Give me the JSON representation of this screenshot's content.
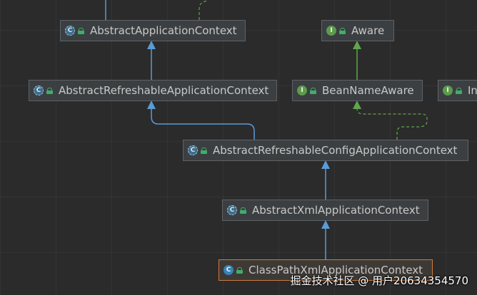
{
  "nodes": {
    "abstract_application_context": {
      "label": "AbstractApplicationContext",
      "icon": "abstract-class-icon",
      "icon_glyph": "C"
    },
    "aware": {
      "label": "Aware",
      "icon": "interface-icon",
      "icon_glyph": "I"
    },
    "abstract_refreshable_application_context": {
      "label": "AbstractRefreshableApplicationContext",
      "icon": "abstract-class-icon",
      "icon_glyph": "C"
    },
    "bean_name_aware": {
      "label": "BeanNameAware",
      "icon": "interface-icon",
      "icon_glyph": "I"
    },
    "cut_off_interface": {
      "label": "In",
      "icon": "interface-icon",
      "icon_glyph": "I"
    },
    "abstract_refreshable_config_application_context": {
      "label": "AbstractRefreshableConfigApplicationContext",
      "icon": "abstract-class-icon",
      "icon_glyph": "C"
    },
    "abstract_xml_application_context": {
      "label": "AbstractXmlApplicationContext",
      "icon": "abstract-class-icon",
      "icon_glyph": "C"
    },
    "class_path_xml_application_context": {
      "label": "ClassPathXmlApplicationContext",
      "icon": "class-icon",
      "icon_glyph": "C"
    }
  },
  "watermark": "掘金技术社区 @ 用户20634354570",
  "colors": {
    "background": "#2b2b2b",
    "extends_arrow": "#5a9bd8",
    "implements_arrow": "#5fa64b",
    "selected_border": "#d07a3a",
    "node_fill": "#3c3f41"
  }
}
